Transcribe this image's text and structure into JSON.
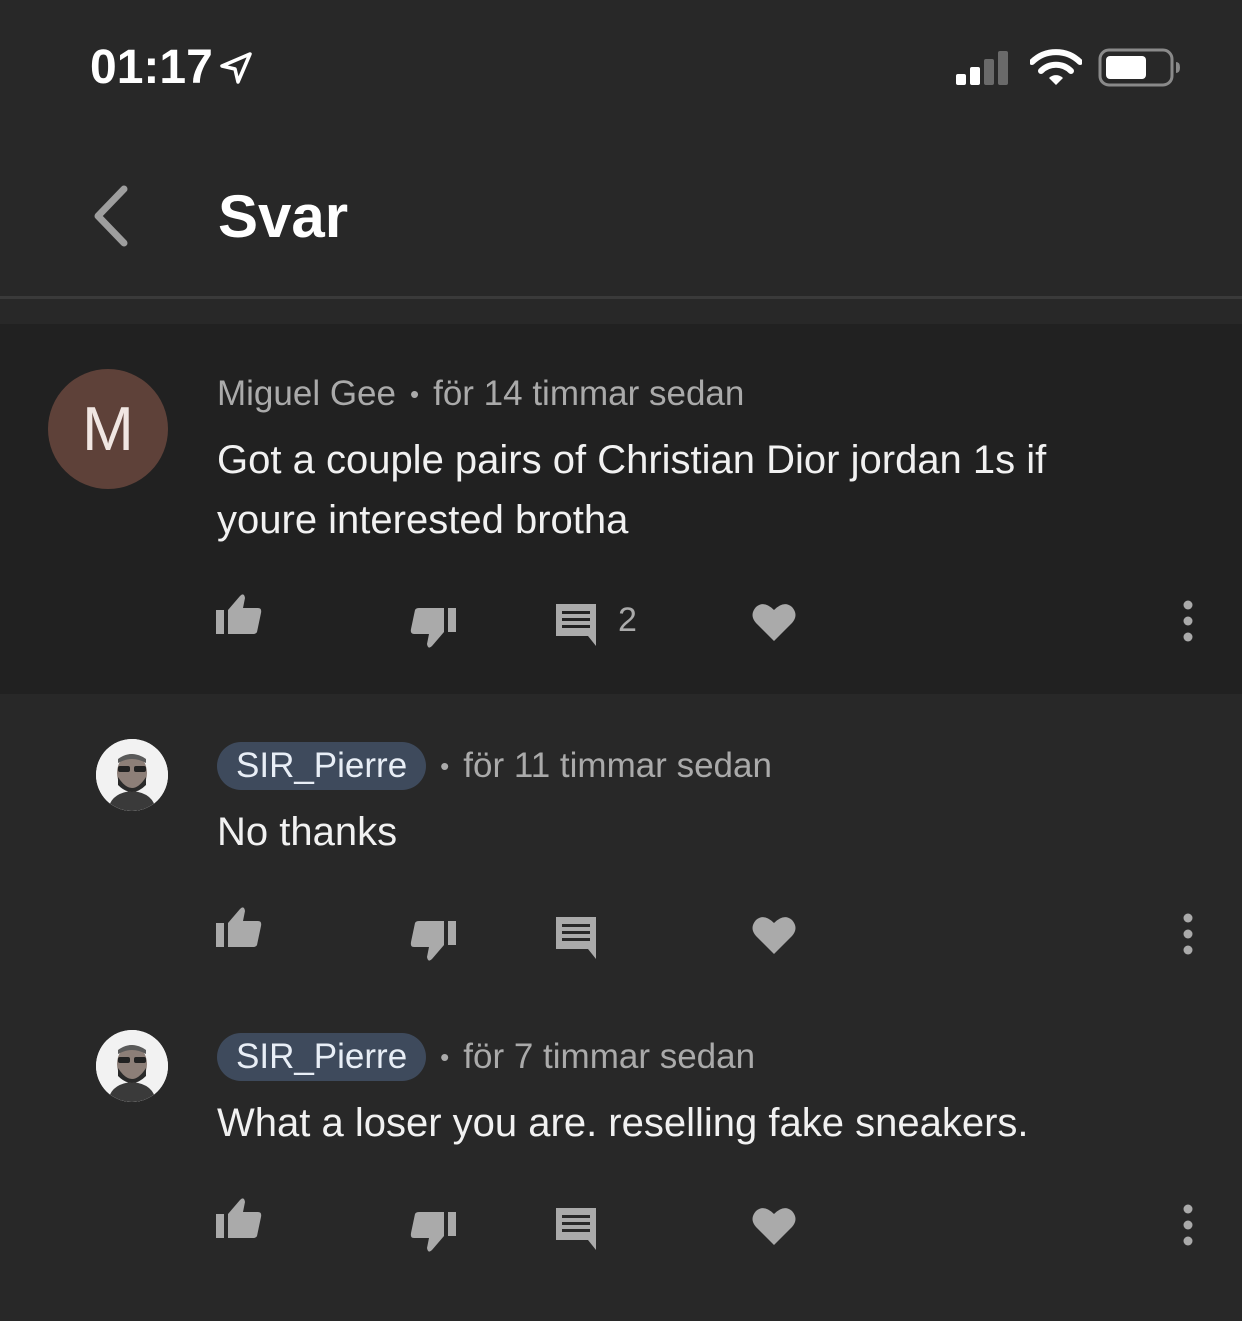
{
  "status_bar": {
    "time": "01:17"
  },
  "header": {
    "title": "Svar"
  },
  "parent_comment": {
    "avatar_letter": "M",
    "author": "Miguel Gee",
    "timestamp": "för 14 timmar sedan",
    "text_line1": "Got a couple pairs of Christian Dior jordan 1s if",
    "text_line2": "youre interested brotha",
    "reply_count": "2"
  },
  "replies": [
    {
      "author": "SIR_Pierre",
      "timestamp": "för 11 timmar sedan",
      "text": "No thanks"
    },
    {
      "author": "SIR_Pierre",
      "timestamp": "för 7 timmar sedan",
      "text": "What a loser you are. reselling fake sneakers."
    }
  ],
  "colors": {
    "background": "#282828",
    "parent_background": "#212121",
    "chip": "#3e4a5c",
    "avatar_m": "#5e4139"
  }
}
